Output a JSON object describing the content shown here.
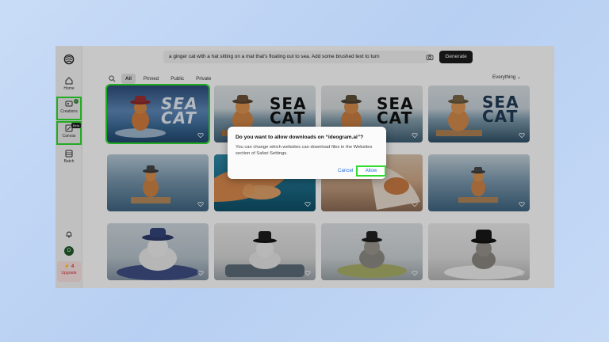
{
  "sidebar": {
    "items": [
      {
        "label": "Home",
        "icon": "home-icon"
      },
      {
        "label": "Creations",
        "icon": "creations-icon"
      },
      {
        "label": "Canvas",
        "icon": "canvas-icon",
        "badge": "Beta"
      },
      {
        "label": "Batch",
        "icon": "batch-icon"
      }
    ],
    "avatar_initial": "D",
    "upgrade": {
      "credits": "4",
      "label": "Upgrade"
    }
  },
  "topbar": {
    "prompt": "a ginger cat with a hat sitting on a mat that's floating out to sea. Add some brushed text to turn",
    "generate_label": "Generate"
  },
  "filters": {
    "tabs": [
      "All",
      "Pinned",
      "Public",
      "Private"
    ],
    "active_tab": "All",
    "sort_label": "Everything"
  },
  "gallery": {
    "posters": [
      {
        "title_line1": "SEA",
        "title_line2": "CAT"
      },
      {
        "title_line1": "SEA",
        "title_line2": "CAT"
      },
      {
        "title_line1": "SEA",
        "title_line2": "CAT"
      },
      {
        "title_line1": "SEA",
        "title_line2": "CAT"
      }
    ]
  },
  "dialog": {
    "title": "Do you want to allow downloads on “ideogram.ai”?",
    "body": "You can change which websites can download files in the Websites section of Safari Settings.",
    "cancel_label": "Cancel",
    "allow_label": "Allow"
  },
  "colors": {
    "highlight": "#2fdc2f",
    "link_blue": "#1d6fe0",
    "upgrade_red": "#d6333a"
  }
}
